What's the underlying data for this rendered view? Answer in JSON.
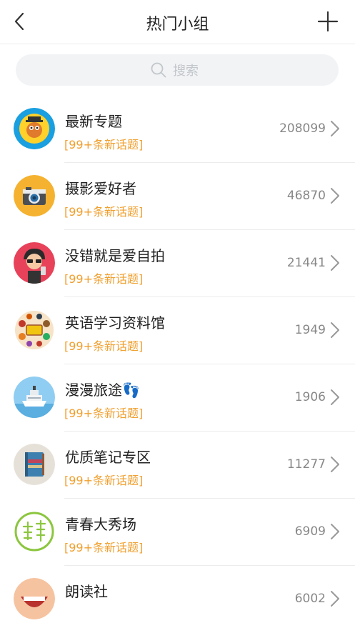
{
  "header": {
    "title": "热门小组"
  },
  "search": {
    "placeholder": "搜索"
  },
  "groups": [
    {
      "name": "最新专题",
      "tag": "[99+条新话题]",
      "count": "208099"
    },
    {
      "name": "摄影爱好者",
      "tag": "[99+条新话题]",
      "count": "46870"
    },
    {
      "name": "没错就是爱自拍",
      "tag": "[99+条新话题]",
      "count": "21441"
    },
    {
      "name": "英语学习资料馆",
      "tag": "[99+条新话题]",
      "count": "1949"
    },
    {
      "name": "漫漫旅途👣",
      "tag": "[99+条新话题]",
      "count": "1906"
    },
    {
      "name": "优质笔记专区",
      "tag": "[99+条新话题]",
      "count": "11277"
    },
    {
      "name": "青春大秀场",
      "tag": "[99+条新话题]",
      "count": "6909"
    },
    {
      "name": "朗读社",
      "tag": "",
      "count": "6002"
    }
  ],
  "icons": {
    "back": "chevron-left-icon",
    "add": "plus-icon",
    "search": "search-icon",
    "row_arrow": "chevron-right-icon"
  },
  "colors": {
    "tag": "#f0a030",
    "count": "#888888",
    "search_bg": "#f1f3f5"
  }
}
